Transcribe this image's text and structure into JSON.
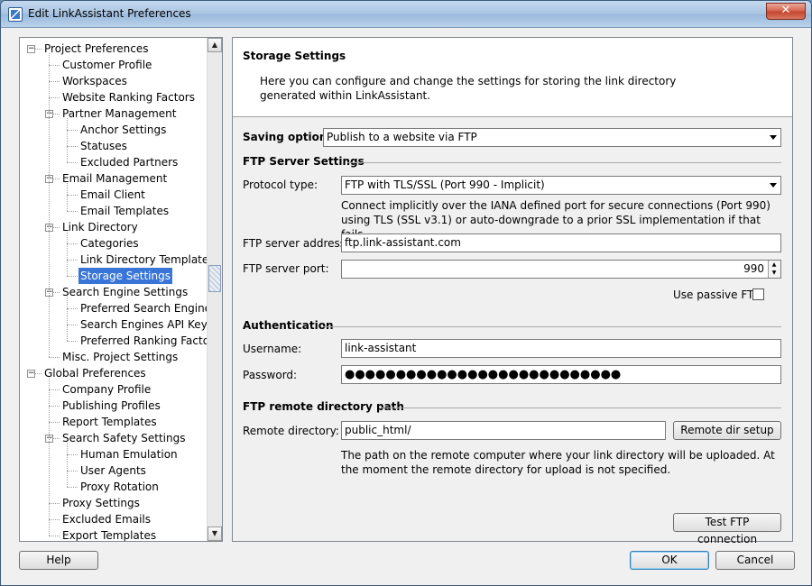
{
  "window": {
    "title": "Edit LinkAssistant Preferences",
    "close_symbol": "✕"
  },
  "tree": {
    "items": [
      {
        "label": "Project Preferences",
        "level": 0,
        "expander": "−"
      },
      {
        "label": "Customer Profile",
        "level": 1
      },
      {
        "label": "Workspaces",
        "level": 1
      },
      {
        "label": "Website Ranking Factors",
        "level": 1
      },
      {
        "label": "Partner Management",
        "level": 1,
        "expander": "−"
      },
      {
        "label": "Anchor Settings",
        "level": 2
      },
      {
        "label": "Statuses",
        "level": 2
      },
      {
        "label": "Excluded Partners",
        "level": 2
      },
      {
        "label": "Email Management",
        "level": 1,
        "expander": "−"
      },
      {
        "label": "Email Client",
        "level": 2
      },
      {
        "label": "Email Templates",
        "level": 2
      },
      {
        "label": "Link Directory",
        "level": 1,
        "expander": "−"
      },
      {
        "label": "Categories",
        "level": 2
      },
      {
        "label": "Link Directory Templates",
        "level": 2
      },
      {
        "label": "Storage Settings",
        "level": 2,
        "selected": true
      },
      {
        "label": "Search Engine Settings",
        "level": 1,
        "expander": "−"
      },
      {
        "label": "Preferred Search Engines",
        "level": 2
      },
      {
        "label": "Search Engines API Keys",
        "level": 2
      },
      {
        "label": "Preferred Ranking Factors",
        "level": 2
      },
      {
        "label": "Misc. Project Settings",
        "level": 1
      },
      {
        "label": "Global Preferences",
        "level": 0,
        "expander": "−"
      },
      {
        "label": "Company Profile",
        "level": 1
      },
      {
        "label": "Publishing Profiles",
        "level": 1
      },
      {
        "label": "Report Templates",
        "level": 1
      },
      {
        "label": "Search Safety Settings",
        "level": 1,
        "expander": "−"
      },
      {
        "label": "Human Emulation",
        "level": 2
      },
      {
        "label": "User Agents",
        "level": 2
      },
      {
        "label": "Proxy Rotation",
        "level": 2
      },
      {
        "label": "Proxy Settings",
        "level": 1
      },
      {
        "label": "Excluded Emails",
        "level": 1
      },
      {
        "label": "Export Templates",
        "level": 1
      }
    ]
  },
  "header": {
    "title": "Storage Settings",
    "description": "Here you can configure and change the settings for storing the link directory generated within LinkAssistant."
  },
  "saving": {
    "label": "Saving option:",
    "value": "Publish to a website via FTP"
  },
  "ftp": {
    "section_title": "FTP Server Settings",
    "protocol_label": "Protocol type:",
    "protocol_value": "FTP with TLS/SSL (Port 990 - Implicit)",
    "protocol_hint": "Connect implicitly over the IANA defined port for secure connections (Port 990) using TLS (SSL v3.1) or auto-downgrade to a prior SSL implementation if that fails.",
    "address_label": "FTP server address:",
    "address_value": "ftp.link-assistant.com",
    "port_label": "FTP server port:",
    "port_value": "990",
    "passive_label": "Use passive FTP",
    "passive_checked": false
  },
  "auth": {
    "section_title": "Authentication",
    "username_label": "Username:",
    "username_value": "link-assistant",
    "password_label": "Password:",
    "password_value": "●●●●●●●●●●●●●●●●●●●●●●●●●●●"
  },
  "remote": {
    "section_title": "FTP remote directory path",
    "dir_label": "Remote directory:",
    "dir_value": "public_html/",
    "setup_button": "Remote dir setup",
    "hint": "The path on the remote computer where your link directory will be uploaded. At the moment the remote directory for upload is not specified."
  },
  "buttons": {
    "test": "Test FTP connection",
    "help": "Help",
    "ok": "OK",
    "cancel": "Cancel"
  }
}
